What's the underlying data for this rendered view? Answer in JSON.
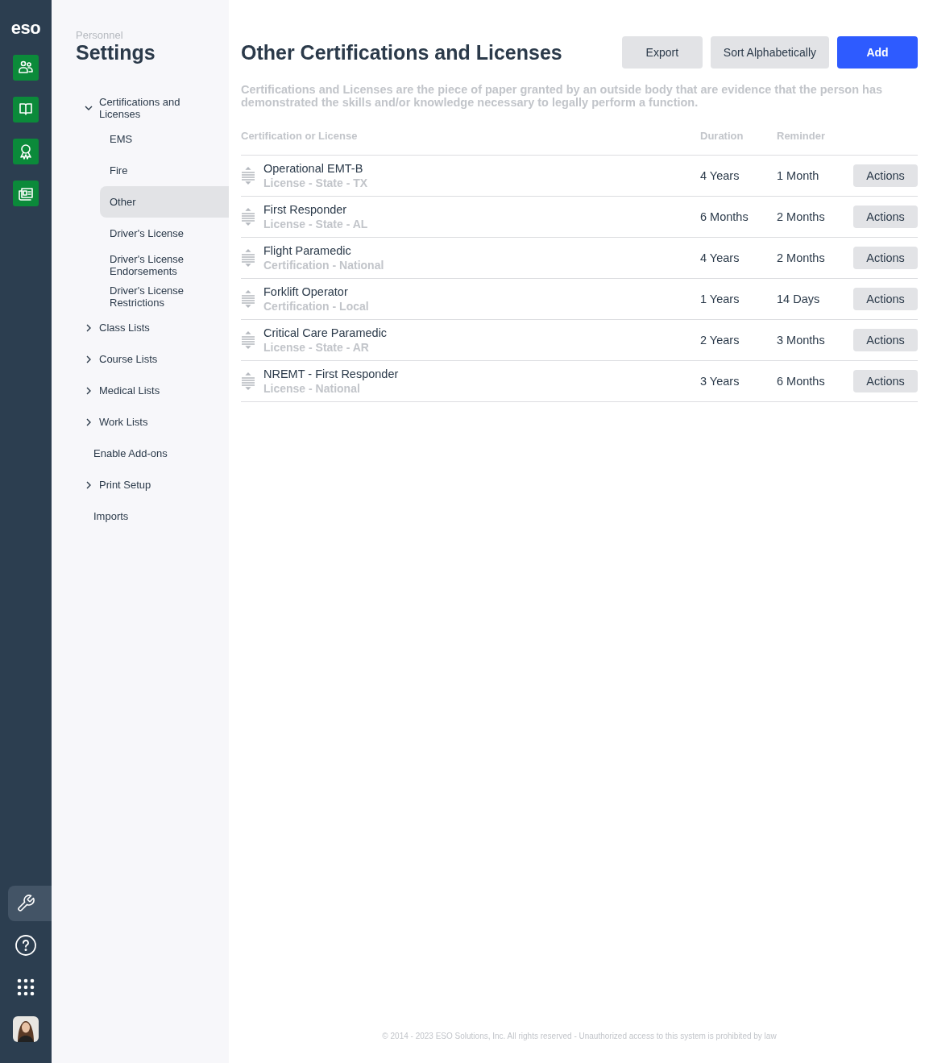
{
  "rail": {
    "logo": "eso",
    "apps": [
      {
        "kind": "people"
      },
      {
        "kind": "book"
      },
      {
        "kind": "award"
      },
      {
        "kind": "news"
      }
    ],
    "tools": [
      {
        "kind": "settings",
        "selected": true
      },
      {
        "kind": "help",
        "selected": false
      },
      {
        "kind": "apps",
        "selected": false
      }
    ]
  },
  "sidebar": {
    "eyebrow": "Personnel",
    "title": "Settings",
    "items": [
      {
        "label": "Certifications and Licenses",
        "expanded": true,
        "selected": false,
        "children": [
          {
            "label": "EMS",
            "selected": false
          },
          {
            "label": "Fire",
            "selected": false
          },
          {
            "label": "Other",
            "selected": true
          },
          {
            "label": "Driver's License",
            "selected": false
          },
          {
            "label": "Driver's License Endorsements",
            "selected": false
          },
          {
            "label": "Driver's License Restrictions",
            "selected": false
          }
        ]
      },
      {
        "label": "Class Lists",
        "expanded": false,
        "selected": false
      },
      {
        "label": "Course Lists",
        "expanded": false,
        "selected": false
      },
      {
        "label": "Medical Lists",
        "expanded": false,
        "selected": false
      },
      {
        "label": "Work Lists",
        "expanded": false,
        "selected": false
      },
      {
        "label": "Enable Add-ons",
        "selected": false
      },
      {
        "label": "Print Setup",
        "expanded": false,
        "selected": false
      },
      {
        "label": "Imports",
        "selected": false
      }
    ]
  },
  "main": {
    "title": "Other Certifications and Licenses",
    "buttons": [
      {
        "label": "Export",
        "kind": "secondary"
      },
      {
        "label": "Sort Alphabetically",
        "kind": "secondary"
      },
      {
        "label": "Add",
        "kind": "primary"
      }
    ],
    "description": "Certifications and Licenses are the piece of paper granted by an outside body that are evidence that the person has demonstrated the skills and/or knowledge necessary to legally perform a function.",
    "table": {
      "columns": [
        "Certification or License",
        "Duration",
        "Reminder"
      ],
      "rows": [
        {
          "name": "Operational EMT-B",
          "type": "License - State - TX",
          "duration": "4 Years",
          "reminder": "1 Month",
          "action": "Actions"
        },
        {
          "name": "First Responder",
          "type": "License - State - AL",
          "duration": "6 Months",
          "reminder": "2 Months",
          "action": "Actions"
        },
        {
          "name": "Flight Paramedic",
          "type": "Certification - National",
          "duration": "4 Years",
          "reminder": "2 Months",
          "action": "Actions"
        },
        {
          "name": "Forklift Operator",
          "type": "Certification - Local",
          "duration": "1 Years",
          "reminder": "14 Days",
          "action": "Actions"
        },
        {
          "name": "Critical Care Paramedic",
          "type": "License - State - AR",
          "duration": "2 Years",
          "reminder": "3 Months",
          "action": "Actions"
        },
        {
          "name": "NREMT - First Responder",
          "type": "License - National",
          "duration": "3 Years",
          "reminder": "6 Months",
          "action": "Actions"
        }
      ]
    }
  },
  "footer": "© 2014 - 2023 ESO Solutions, Inc. All rights reserved - Unauthorized access to this system is prohibited by law"
}
